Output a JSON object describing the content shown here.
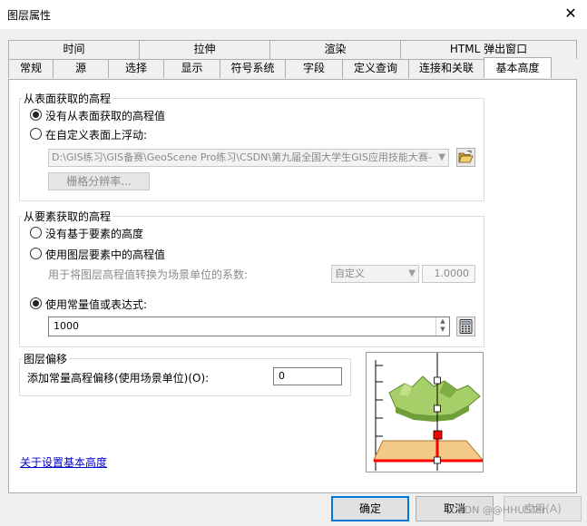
{
  "window": {
    "title": "图层属性",
    "close_glyph": "✕"
  },
  "tabs_row1": [
    "时间",
    "拉伸",
    "渲染",
    "HTML 弹出窗口"
  ],
  "tabs_row2": [
    "常规",
    "源",
    "选择",
    "显示",
    "符号系统",
    "字段",
    "定义查询",
    "连接和关联",
    "基本高度"
  ],
  "active_tab": "基本高度",
  "surface": {
    "legend": "从表面获取的高程",
    "opt_none": "没有从表面获取的高程值",
    "opt_float": "在自定义表面上浮动:",
    "path_value": "D:\\GIS练习\\GIS备赛\\GeoScene Pro练习\\CSDN\\第九届全国大学生GIS应用技能大赛-",
    "raster_resolution_label": "栅格分辨率..."
  },
  "feature": {
    "legend": "从要素获取的高程",
    "opt_none": "没有基于要素的高度",
    "opt_layer": "使用图层要素中的高程值",
    "factor_label": "用于将图层高程值转换为场景单位的系数:",
    "unit_value": "自定义",
    "factor_value": "1.0000",
    "opt_constant": "使用常量值或表达式:",
    "constant_value": "1000"
  },
  "offset": {
    "legend": "图层偏移",
    "label": "添加常量高程偏移(使用场景单位)(O):",
    "value": "0"
  },
  "help_link": "关于设置基本高度",
  "buttons": {
    "ok": "确定",
    "cancel": "取消",
    "apply": "应用(A)"
  },
  "watermark": "CSDN @@HHUSTer",
  "icons": {
    "close": "close-icon",
    "open_folder": "open-folder-icon",
    "calculator": "calculator-icon",
    "dropdown": "chevron-down-icon"
  },
  "colors": {
    "accent": "#0078d7",
    "link": "#0000cc",
    "terrain": "#8fc15a",
    "plane": "#f3c98a",
    "marker": "#ff0000"
  },
  "state": {
    "surface_option": "none",
    "feature_option": "constant"
  }
}
